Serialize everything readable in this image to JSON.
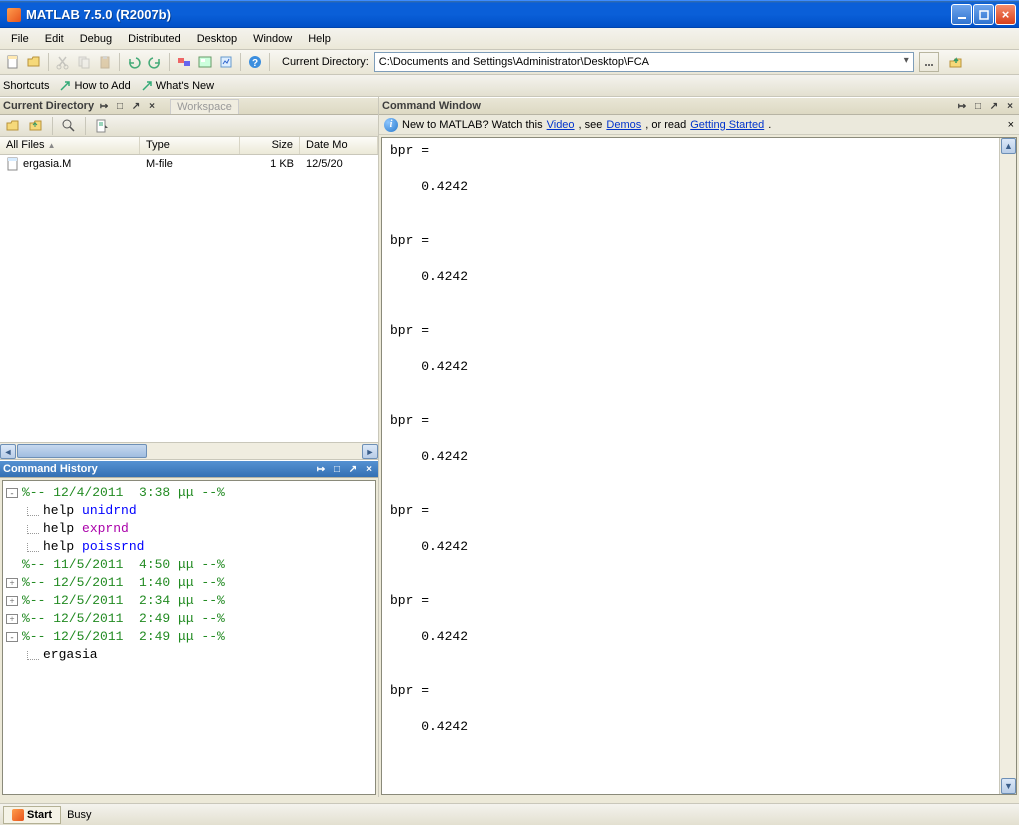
{
  "titlebar": {
    "title": "MATLAB  7.5.0  (R2007b)"
  },
  "menu": {
    "items": [
      "File",
      "Edit",
      "Debug",
      "Distributed",
      "Desktop",
      "Window",
      "Help"
    ]
  },
  "toolbar": {
    "dir_label": "Current Directory:",
    "dir_value": "C:\\Documents and Settings\\Administrator\\Desktop\\FCA"
  },
  "shortcuts": {
    "label": "Shortcuts",
    "howto": "How to Add",
    "whatsnew": "What's New"
  },
  "curdir": {
    "title": "Current Directory",
    "tab2": "Workspace",
    "columns": {
      "name": "All Files",
      "type": "Type",
      "size": "Size",
      "date": "Date Mo"
    },
    "rows": [
      {
        "name": "ergasia.M",
        "type": "M-file",
        "size": "1 KB",
        "date": "12/5/20"
      }
    ]
  },
  "history": {
    "title": "Command History",
    "lines": [
      {
        "glyph": "-",
        "cls": "green-cmt",
        "indent": 0,
        "text": "%-- 12/4/2011  3:38 μμ --%"
      },
      {
        "glyph": "",
        "cls": "",
        "indent": 1,
        "conn": true,
        "text_parts": [
          [
            "black-txt",
            "help "
          ],
          [
            "blue-fn",
            "unidrnd"
          ]
        ]
      },
      {
        "glyph": "",
        "cls": "",
        "indent": 1,
        "conn": true,
        "text_parts": [
          [
            "black-txt",
            "help "
          ],
          [
            "purple-fn",
            "exprnd"
          ]
        ]
      },
      {
        "glyph": "",
        "cls": "",
        "indent": 1,
        "conn": true,
        "text_parts": [
          [
            "black-txt",
            "help "
          ],
          [
            "blue-fn",
            "poissrnd"
          ]
        ]
      },
      {
        "glyph": "",
        "cls": "green-cmt",
        "indent": 0,
        "nobox": true,
        "text": "%-- 11/5/2011  4:50 μμ --%"
      },
      {
        "glyph": "+",
        "cls": "green-cmt",
        "indent": 0,
        "text": "%-- 12/5/2011  1:40 μμ --%"
      },
      {
        "glyph": "+",
        "cls": "green-cmt",
        "indent": 0,
        "text": "%-- 12/5/2011  2:34 μμ --%"
      },
      {
        "glyph": "+",
        "cls": "green-cmt",
        "indent": 0,
        "text": "%-- 12/5/2011  2:49 μμ --%"
      },
      {
        "glyph": "-",
        "cls": "green-cmt",
        "indent": 0,
        "text": "%-- 12/5/2011  2:49 μμ --%"
      },
      {
        "glyph": "",
        "cls": "",
        "indent": 1,
        "conn": true,
        "text_parts": [
          [
            "black-txt",
            "ergasia"
          ]
        ]
      }
    ]
  },
  "cmdwin": {
    "title": "Command Window",
    "info_pre": "New to MATLAB? Watch this ",
    "info_link1": "Video",
    "info_mid1": ", see ",
    "info_link2": "Demos",
    "info_mid2": ", or read ",
    "info_link3": "Getting Started",
    "info_end": ".",
    "output": "bpr =\n\n    0.4242\n\n\nbpr =\n\n    0.4242\n\n\nbpr =\n\n    0.4242\n\n\nbpr =\n\n    0.4242\n\n\nbpr =\n\n    0.4242\n\n\nbpr =\n\n    0.4242\n\n\nbpr =\n\n    0.4242\n"
  },
  "status": {
    "start": "Start",
    "msg": "Busy"
  }
}
